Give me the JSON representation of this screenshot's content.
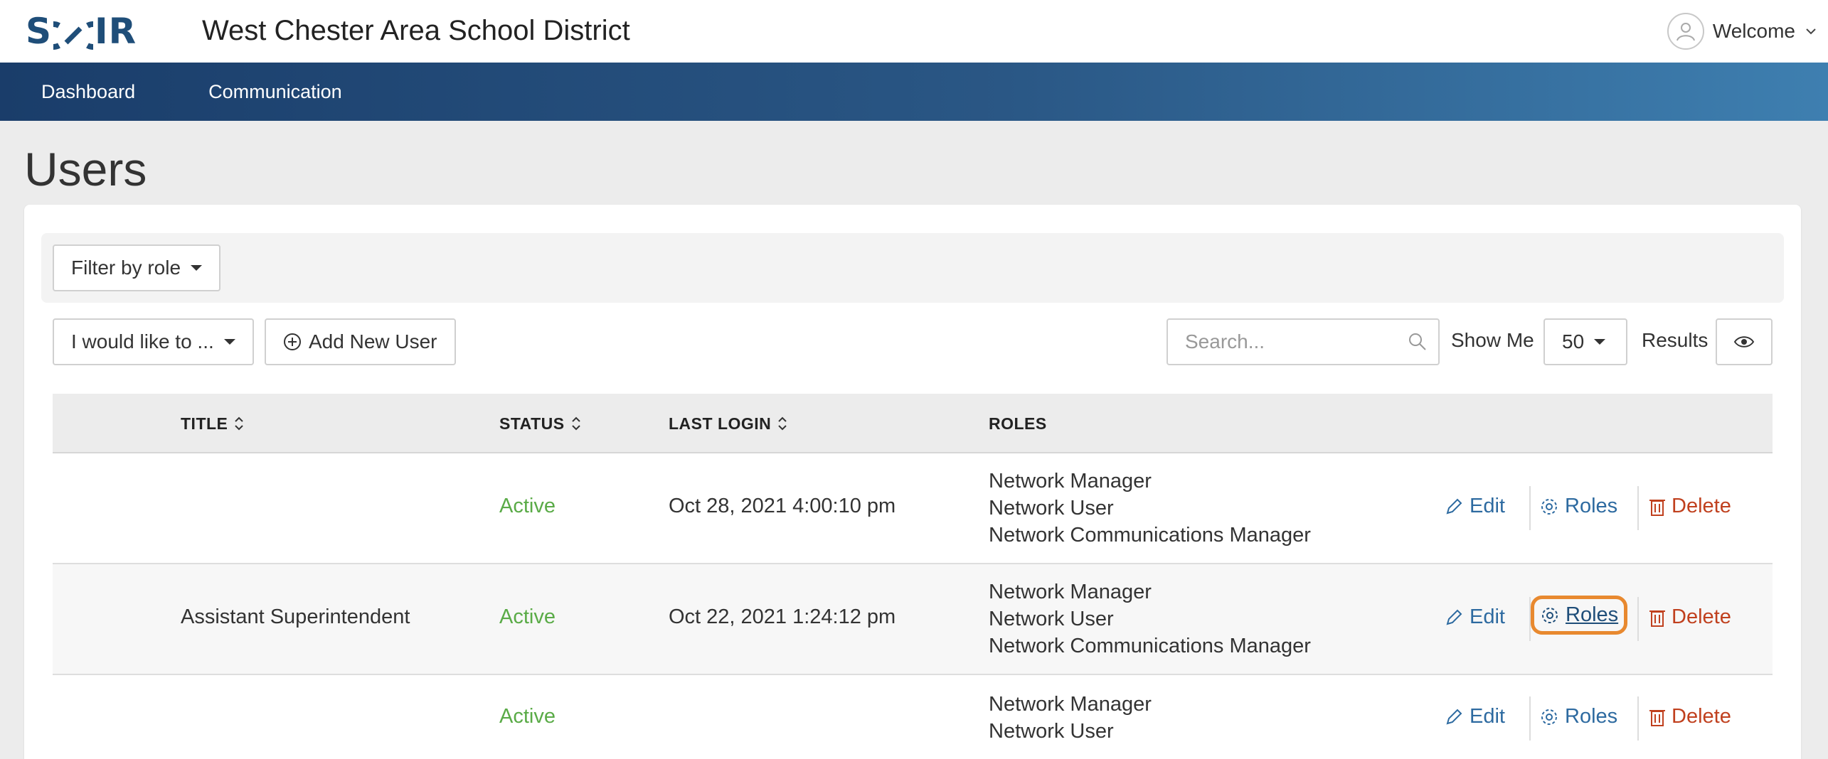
{
  "header": {
    "logo_text": "SCOIR",
    "district_name": "West Chester Area School District",
    "user_menu_label": "Welcome"
  },
  "nav": {
    "items": [
      "Dashboard",
      "Communication"
    ]
  },
  "page": {
    "title": "Users"
  },
  "toolbar": {
    "filter_label": "Filter by role",
    "action_dropdown_label": "I would like to ...",
    "add_user_label": "Add New User",
    "search_placeholder": "Search...",
    "show_me_label": "Show Me",
    "page_size": "50",
    "results_label": "Results"
  },
  "table": {
    "columns": [
      "TITLE",
      "STATUS",
      "LAST LOGIN",
      "ROLES"
    ],
    "action_labels": {
      "edit": "Edit",
      "roles": "Roles",
      "delete": "Delete"
    },
    "rows": [
      {
        "title": "",
        "status": "Active",
        "last_login": "Oct 28, 2021 4:00:10 pm",
        "roles": [
          "Network Manager",
          "Network User",
          "Network Communications Manager"
        ]
      },
      {
        "title": "Assistant Superintendent",
        "status": "Active",
        "last_login": "Oct 22, 2021 1:24:12 pm",
        "roles": [
          "Network Manager",
          "Network User",
          "Network Communications Manager"
        ]
      },
      {
        "title": "",
        "status": "Active",
        "last_login": "",
        "roles": [
          "Network Manager",
          "Network User"
        ]
      }
    ]
  },
  "colors": {
    "brand": "#1f4e79",
    "status_active": "#5aab47",
    "link": "#2d6aa0",
    "delete": "#c0401e",
    "highlight": "#e8892f"
  }
}
